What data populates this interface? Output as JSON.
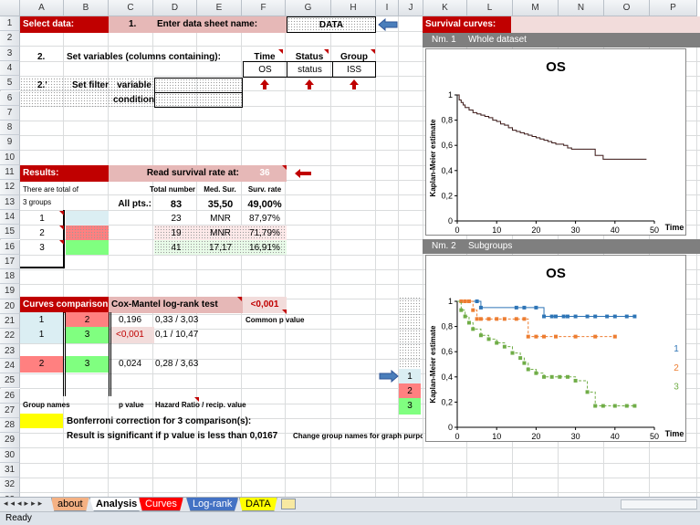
{
  "columns": [
    "A",
    "B",
    "C",
    "D",
    "E",
    "F",
    "G",
    "H",
    "I",
    "J",
    "K",
    "L",
    "M",
    "N",
    "O",
    "P"
  ],
  "rows": [
    "1",
    "2",
    "3",
    "4",
    "5",
    "6",
    "7",
    "8",
    "9",
    "10",
    "11",
    "12",
    "13",
    "14",
    "15",
    "16",
    "17",
    "18",
    "19",
    "20",
    "21",
    "22",
    "23",
    "24",
    "25",
    "26",
    "27",
    "28",
    "29",
    "30",
    "31",
    "32",
    "33"
  ],
  "setup": {
    "select_data": "Select data:",
    "step1": "1.",
    "enter_sheet": "Enter data sheet  name:",
    "sheet_value": "DATA",
    "step2": "2.",
    "set_variables": "Set variables (columns containing):",
    "hdr_time": "Time",
    "hdr_status": "Status",
    "hdr_group": "Group",
    "val_time": "OS",
    "val_status": "status",
    "val_group": "ISS",
    "step2b": "2.'",
    "set_filter": "Set filter",
    "variable": "variable",
    "condition": "condition"
  },
  "results": {
    "title": "Results:",
    "read_rate": "Read survival rate at:",
    "rate_value": "36",
    "total_text1": "There are total of",
    "total_text2": "3 groups",
    "col_total": "Total number",
    "col_med": "Med. Sur.",
    "col_surv": "Surv. rate",
    "all_label": "All pts.:",
    "all_total": "83",
    "all_med": "35,50",
    "all_surv": "49,00%",
    "groups": [
      {
        "name": "1",
        "total": "23",
        "med": "MNR",
        "surv": "87,97%"
      },
      {
        "name": "2",
        "total": "19",
        "med": "MNR",
        "surv": "71,79%"
      },
      {
        "name": "3",
        "total": "41",
        "med": "17,17",
        "surv": "16,91%"
      }
    ]
  },
  "comparison": {
    "title": "Curves comparison:",
    "test": "Cox-Mantel log-rank test",
    "common_p": "<0,001",
    "common_label": "Common p value",
    "rows": [
      {
        "a": "1",
        "b": "2",
        "p": "0,196",
        "hr": "0,33 / 3,03"
      },
      {
        "a": "1",
        "b": "3",
        "p": "<0,001",
        "hr": "0,1 / 10,47"
      },
      {
        "a": "2",
        "b": "3",
        "p": "0,024",
        "hr": "0,28 / 3,63"
      }
    ],
    "group_names": "Group names",
    "p_value": "p value",
    "hazard": "Hazard Ratio / recip. value",
    "bonferroni": "Bonferroni correction for 3 comparison(s):",
    "significant": "Result is significant if p value is less than 0,0167",
    "change_names": "Change group names for graph purposes:",
    "group_side": [
      "1",
      "2",
      "3"
    ]
  },
  "survival": {
    "title": "Survival curves:",
    "chart1_label": "Nm. 1",
    "chart1_sub": "Whole dataset",
    "chart2_label": "Nm. 2",
    "chart2_sub": "Subgroups"
  },
  "chart_data": [
    {
      "type": "line",
      "title": "OS",
      "xlabel": "Time",
      "ylabel": "Kaplan-Meier estimate",
      "xlim": [
        0,
        50
      ],
      "ylim": [
        0,
        1
      ],
      "xticks": [
        "0",
        "10",
        "20",
        "30",
        "40",
        "50"
      ],
      "yticks": [
        "0",
        "0,2",
        "0,4",
        "0,6",
        "0,8",
        "1"
      ],
      "series": [
        {
          "color": "#000000",
          "x": [
            0,
            0.5,
            1,
            1.5,
            2,
            3,
            4,
            5,
            6,
            7,
            8,
            9,
            10,
            11,
            12,
            13,
            14,
            15,
            16,
            17,
            18,
            19,
            20,
            21,
            22,
            23,
            24,
            25,
            26,
            27,
            28,
            29,
            30,
            31,
            32,
            33,
            34,
            35,
            36,
            37,
            38,
            39,
            40,
            41,
            42,
            43,
            44,
            45,
            46,
            47,
            48
          ],
          "y": [
            1,
            0.96,
            0.94,
            0.92,
            0.9,
            0.88,
            0.86,
            0.85,
            0.84,
            0.83,
            0.82,
            0.8,
            0.79,
            0.77,
            0.76,
            0.74,
            0.72,
            0.71,
            0.7,
            0.69,
            0.68,
            0.67,
            0.66,
            0.65,
            0.64,
            0.63,
            0.62,
            0.61,
            0.61,
            0.6,
            0.58,
            0.57,
            0.57,
            0.57,
            0.57,
            0.57,
            0.57,
            0.52,
            0.52,
            0.49,
            0.49,
            0.49,
            0.49,
            0.49,
            0.49,
            0.49,
            0.49,
            0.49,
            0.49,
            0.49,
            0.49
          ]
        }
      ]
    },
    {
      "type": "line",
      "title": "OS",
      "xlabel": "Time",
      "ylabel": "Kaplan-Meier estimate",
      "xlim": [
        0,
        50
      ],
      "ylim": [
        0,
        1
      ],
      "xticks": [
        "0",
        "10",
        "20",
        "30",
        "40",
        "50"
      ],
      "yticks": [
        "0",
        "0,2",
        "0,4",
        "0,6",
        "0,8",
        "1"
      ],
      "series": [
        {
          "name": "1",
          "color": "#2e75b6",
          "x": [
            0,
            5,
            6,
            15,
            17,
            20,
            22,
            24,
            25,
            27,
            28,
            30,
            33,
            35,
            38,
            40,
            43,
            45
          ],
          "y": [
            1,
            1,
            0.95,
            0.95,
            0.95,
            0.95,
            0.88,
            0.88,
            0.88,
            0.88,
            0.88,
            0.88,
            0.88,
            0.88,
            0.88,
            0.88,
            0.88,
            0.88
          ]
        },
        {
          "name": "2",
          "color": "#ed7d31",
          "x": [
            0,
            1,
            2,
            3,
            4,
            5,
            6,
            8,
            10,
            12,
            15,
            17,
            18,
            20,
            22,
            25,
            30,
            35,
            40
          ],
          "y": [
            1,
            1,
            1,
            1,
            0.93,
            0.86,
            0.86,
            0.86,
            0.86,
            0.86,
            0.86,
            0.86,
            0.72,
            0.72,
            0.72,
            0.72,
            0.72,
            0.72,
            0.72
          ]
        },
        {
          "name": "3",
          "color": "#70ad47",
          "x": [
            0,
            1,
            2,
            3,
            4,
            6,
            8,
            10,
            12,
            14,
            16,
            17,
            18,
            20,
            22,
            24,
            26,
            28,
            30,
            33,
            35,
            37,
            40,
            43,
            45
          ],
          "y": [
            1,
            0.93,
            0.88,
            0.83,
            0.78,
            0.73,
            0.7,
            0.67,
            0.64,
            0.59,
            0.55,
            0.51,
            0.46,
            0.43,
            0.4,
            0.4,
            0.4,
            0.4,
            0.37,
            0.28,
            0.17,
            0.17,
            0.17,
            0.17,
            0.17
          ]
        }
      ]
    }
  ]
}
